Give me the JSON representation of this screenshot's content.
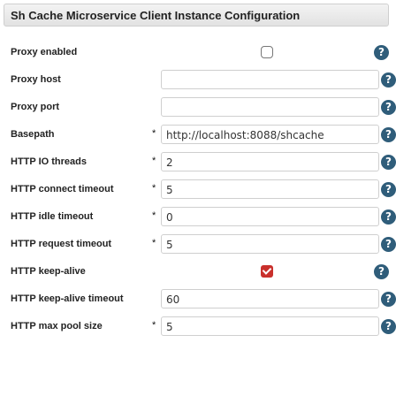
{
  "title": "Sh Cache Microservice Client Instance Configuration",
  "required_mark": "*",
  "help_glyph": "?",
  "icons": {
    "help": "help-icon",
    "required": "required-asterisk"
  },
  "fields": [
    {
      "label": "Proxy enabled",
      "type": "checkbox",
      "checked": false
    },
    {
      "label": "Proxy host",
      "type": "text",
      "value": ""
    },
    {
      "label": "Proxy port",
      "type": "text",
      "value": ""
    },
    {
      "label": "Basepath",
      "type": "text",
      "required": true,
      "value": "http://localhost:8088/shcache"
    },
    {
      "label": "HTTP IO threads",
      "type": "text",
      "required": true,
      "value": "2"
    },
    {
      "label": "HTTP connect timeout",
      "type": "text",
      "required": true,
      "value": "5"
    },
    {
      "label": "HTTP idle timeout",
      "type": "text",
      "required": true,
      "value": "0"
    },
    {
      "label": "HTTP request timeout",
      "type": "text",
      "required": true,
      "value": "5"
    },
    {
      "label": "HTTP keep-alive",
      "type": "checkbox",
      "checked": true
    },
    {
      "label": "HTTP keep-alive timeout",
      "type": "text",
      "value": "60"
    },
    {
      "label": "HTTP max pool size",
      "type": "text",
      "required": true,
      "value": "5"
    }
  ],
  "colors": {
    "help": "#2f5d7a",
    "checked": "#c9302c"
  }
}
